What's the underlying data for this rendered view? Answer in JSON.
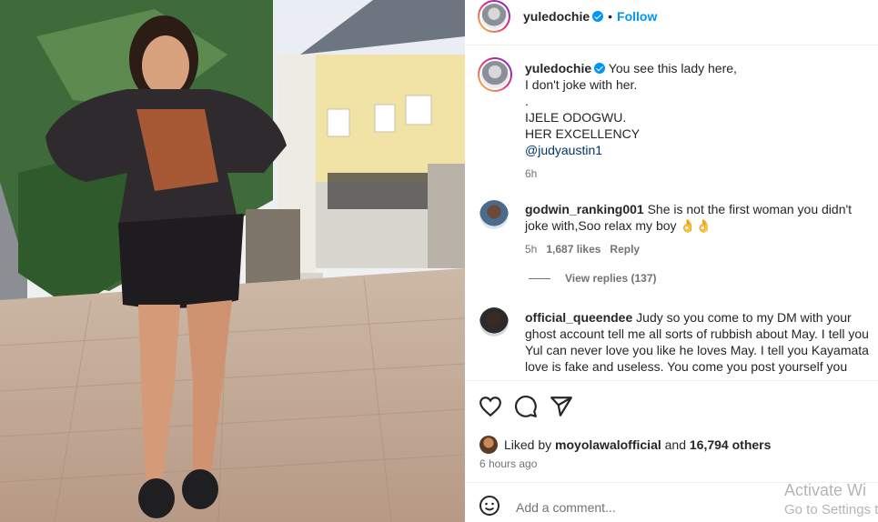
{
  "post": {
    "username": "yuledochie",
    "follow_label": "Follow",
    "separator": "•"
  },
  "caption": {
    "username": "yuledochie",
    "lines": [
      "You see this lady here,",
      "I don't joke with her.",
      ".",
      "IJELE ODOGWU.",
      "HER EXCELLENCY"
    ],
    "mention": "@judyaustin1",
    "time": "6h"
  },
  "comments": [
    {
      "username": "godwin_ranking001",
      "text": "She is not the first woman you didn't joke with,Soo relax my boy 👌👌",
      "time": "5h",
      "likes": "1,687 likes",
      "reply": "Reply"
    },
    {
      "username": "official_queendee",
      "text": "Judy so you come to my DM with your ghost account tell me all sorts of rubbish about May. I tell you Yul can never love you like he loves May. I tell you Kayamata love is fake and useless. You come you post yourself you come"
    }
  ],
  "view_replies": "View replies (137)",
  "likes": {
    "prefix": "Liked by",
    "user": "moyolawalofficial",
    "and": "and",
    "others": "16,794 others"
  },
  "timestamp": "6 hours ago",
  "add_comment_placeholder": "Add a comment...",
  "watermark": {
    "line1": "Activate Wi",
    "line2": "Go to Settings t"
  },
  "icons": [
    "heart-icon",
    "comment-icon",
    "share-icon",
    "emoji-icon",
    "verified-icon"
  ],
  "colors": {
    "link": "#0095f6",
    "mention": "#00376b",
    "muted": "#737373",
    "text": "#262626"
  }
}
